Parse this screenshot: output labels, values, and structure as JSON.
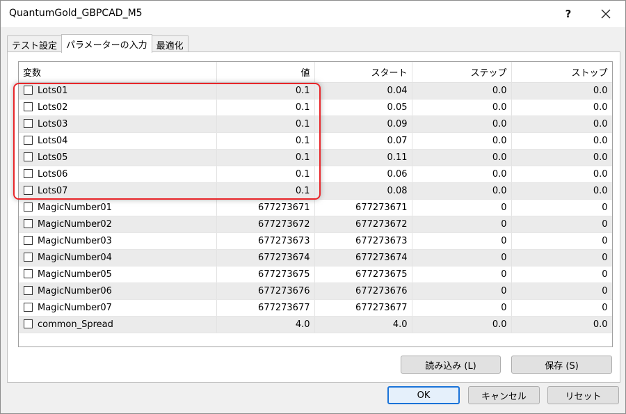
{
  "window": {
    "title": "QuantumGold_GBPCAD_M5",
    "help_label": "?"
  },
  "tabs": [
    {
      "label": "テスト設定",
      "active": false
    },
    {
      "label": "パラメーターの入力",
      "active": true
    },
    {
      "label": "最適化",
      "active": false
    }
  ],
  "grid": {
    "columns": [
      "変数",
      "値",
      "スタート",
      "ステップ",
      "ストップ"
    ],
    "rows": [
      {
        "name": "Lots01",
        "value": "0.1",
        "start": "0.04",
        "step": "0.0",
        "stop": "0.0"
      },
      {
        "name": "Lots02",
        "value": "0.1",
        "start": "0.05",
        "step": "0.0",
        "stop": "0.0"
      },
      {
        "name": "Lots03",
        "value": "0.1",
        "start": "0.09",
        "step": "0.0",
        "stop": "0.0"
      },
      {
        "name": "Lots04",
        "value": "0.1",
        "start": "0.07",
        "step": "0.0",
        "stop": "0.0"
      },
      {
        "name": "Lots05",
        "value": "0.1",
        "start": "0.11",
        "step": "0.0",
        "stop": "0.0"
      },
      {
        "name": "Lots06",
        "value": "0.1",
        "start": "0.06",
        "step": "0.0",
        "stop": "0.0"
      },
      {
        "name": "Lots07",
        "value": "0.1",
        "start": "0.08",
        "step": "0.0",
        "stop": "0.0"
      },
      {
        "name": "MagicNumber01",
        "value": "677273671",
        "start": "677273671",
        "step": "0",
        "stop": "0"
      },
      {
        "name": "MagicNumber02",
        "value": "677273672",
        "start": "677273672",
        "step": "0",
        "stop": "0"
      },
      {
        "name": "MagicNumber03",
        "value": "677273673",
        "start": "677273673",
        "step": "0",
        "stop": "0"
      },
      {
        "name": "MagicNumber04",
        "value": "677273674",
        "start": "677273674",
        "step": "0",
        "stop": "0"
      },
      {
        "name": "MagicNumber05",
        "value": "677273675",
        "start": "677273675",
        "step": "0",
        "stop": "0"
      },
      {
        "name": "MagicNumber06",
        "value": "677273676",
        "start": "677273676",
        "step": "0",
        "stop": "0"
      },
      {
        "name": "MagicNumber07",
        "value": "677273677",
        "start": "677273677",
        "step": "0",
        "stop": "0"
      },
      {
        "name": "common_Spread",
        "value": "4.0",
        "start": "4.0",
        "step": "0.0",
        "stop": "0.0"
      }
    ]
  },
  "buttons": {
    "load": "読み込み (L)",
    "save": "保存 (S)",
    "ok": "OK",
    "cancel": "キャンセル",
    "reset": "リセット"
  },
  "colors": {
    "highlight": "#e8262a",
    "default_button_border": "#1a73d8"
  },
  "icons": {
    "close": "close-icon",
    "help": "help-icon",
    "checkbox": "checkbox-unchecked"
  }
}
